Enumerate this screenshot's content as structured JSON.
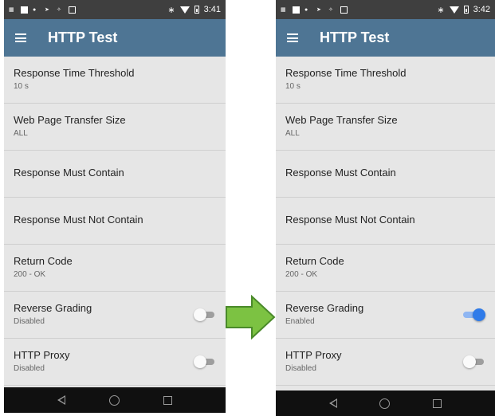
{
  "left": {
    "status": {
      "time": "3:41",
      "bluetooth_icon": "bluetooth-icon",
      "wifi_icon": "wifi-icon",
      "battery_icon": "battery-icon"
    },
    "appbar": {
      "title": "HTTP Test"
    },
    "rows": [
      {
        "title": "Response Time Threshold",
        "sub": "10 s"
      },
      {
        "title": "Web Page Transfer Size",
        "sub": "ALL"
      },
      {
        "title": "Response Must Contain",
        "sub": ""
      },
      {
        "title": "Response Must Not Contain",
        "sub": ""
      },
      {
        "title": "Return Code",
        "sub": "200 - OK"
      },
      {
        "title": "Reverse Grading",
        "sub": "Disabled",
        "toggle": "off"
      },
      {
        "title": "HTTP Proxy",
        "sub": "Disabled",
        "toggle": "off"
      }
    ]
  },
  "right": {
    "status": {
      "time": "3:42",
      "bluetooth_icon": "bluetooth-icon",
      "wifi_icon": "wifi-icon",
      "battery_icon": "battery-icon"
    },
    "appbar": {
      "title": "HTTP Test"
    },
    "rows": [
      {
        "title": "Response Time Threshold",
        "sub": "10 s"
      },
      {
        "title": "Web Page Transfer Size",
        "sub": "ALL"
      },
      {
        "title": "Response Must Contain",
        "sub": ""
      },
      {
        "title": "Response Must Not Contain",
        "sub": ""
      },
      {
        "title": "Return Code",
        "sub": "200 - OK"
      },
      {
        "title": "Reverse Grading",
        "sub": "Enabled",
        "toggle": "on"
      },
      {
        "title": "HTTP Proxy",
        "sub": "Disabled",
        "toggle": "off"
      }
    ]
  },
  "colors": {
    "appbar": "#4e7594",
    "list_bg": "#e6e6e6",
    "toggle_on": "#2f7be9",
    "arrow_fill": "#7cc242",
    "arrow_stroke": "#4a8a2a"
  },
  "arrow": {
    "icon": "right-arrow-icon"
  }
}
